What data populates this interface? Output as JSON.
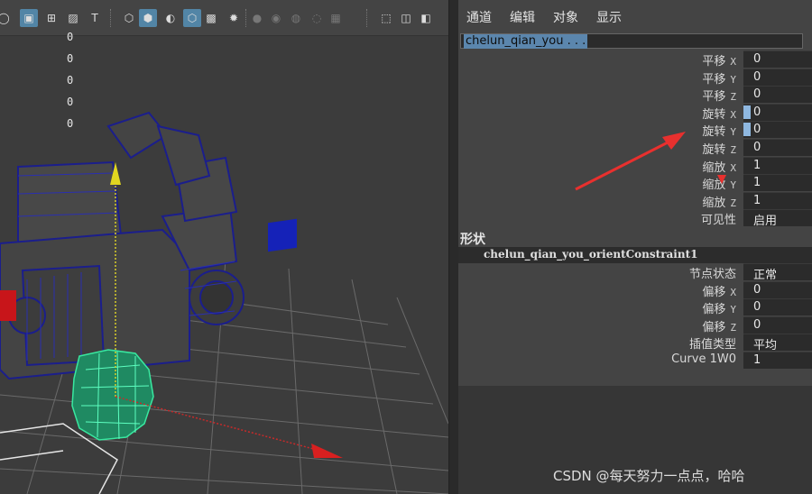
{
  "toolbar": {
    "icons": [
      {
        "name": "ring-icon",
        "glyph": "◯",
        "on": false,
        "dim": false
      },
      {
        "name": "film-gate-icon",
        "glyph": "▣",
        "on": true,
        "dim": false
      },
      {
        "name": "grid-icon",
        "glyph": "⊞",
        "on": false,
        "dim": false
      },
      {
        "name": "image-plane-icon",
        "glyph": "▨",
        "on": false,
        "dim": false
      },
      {
        "name": "text-icon",
        "glyph": "T",
        "on": false,
        "dim": false
      },
      {
        "name": "wireframe-cube-icon",
        "glyph": "⬡",
        "on": false,
        "dim": false
      },
      {
        "name": "smooth-shade-icon",
        "glyph": "⬢",
        "on": true,
        "dim": false
      },
      {
        "name": "default-material-icon",
        "glyph": "◐",
        "on": false,
        "dim": false
      },
      {
        "name": "wireframe-on-shaded-icon",
        "glyph": "⬡",
        "on": true,
        "dim": false
      },
      {
        "name": "xray-icon",
        "glyph": "▩",
        "on": false,
        "dim": false
      },
      {
        "name": "lights-icon",
        "glyph": "✹",
        "on": false,
        "dim": false
      },
      {
        "name": "shadows-icon",
        "glyph": "●",
        "on": false,
        "dim": true
      },
      {
        "name": "ambient-occlusion-icon",
        "glyph": "◉",
        "on": false,
        "dim": true
      },
      {
        "name": "motion-blur-icon",
        "glyph": "◍",
        "on": false,
        "dim": true
      },
      {
        "name": "antialias-icon",
        "glyph": "◌",
        "on": false,
        "dim": true
      },
      {
        "name": "depth-icon",
        "glyph": "▦",
        "on": false,
        "dim": true
      },
      {
        "name": "isolate-select-icon",
        "glyph": "⬚",
        "on": false,
        "dim": false
      },
      {
        "name": "xray-joints-icon",
        "glyph": "◫",
        "on": false,
        "dim": false
      },
      {
        "name": "xray-active-icon",
        "glyph": "◧",
        "on": false,
        "dim": false
      }
    ]
  },
  "viewport": {
    "channel_values": [
      "0",
      "0",
      "0",
      "0",
      "0"
    ]
  },
  "panel": {
    "menu": [
      "通道",
      "编辑",
      "对象",
      "显示"
    ],
    "object_name": "chelun_qian_you . . .",
    "attributes": [
      {
        "label": "平移",
        "axis": "X",
        "value": "0"
      },
      {
        "label": "平移",
        "axis": "Y",
        "value": "0"
      },
      {
        "label": "平移",
        "axis": "Z",
        "value": "0"
      },
      {
        "label": "旋转",
        "axis": "X",
        "value": "0"
      },
      {
        "label": "旋转",
        "axis": "Y",
        "value": "0"
      },
      {
        "label": "旋转",
        "axis": "Z",
        "value": "0"
      },
      {
        "label": "缩放",
        "axis": "X",
        "value": "1"
      },
      {
        "label": "缩放",
        "axis": "Y",
        "value": "1"
      },
      {
        "label": "缩放",
        "axis": "Z",
        "value": "1"
      },
      {
        "label": "可见性",
        "axis": "",
        "value": "启用"
      }
    ],
    "shape_heading": "形状",
    "input_node": "chelun_qian_you_orientConstraint1",
    "input_attributes": [
      {
        "label": "节点状态",
        "axis": "",
        "value": "正常"
      },
      {
        "label": "偏移",
        "axis": "X",
        "value": "0"
      },
      {
        "label": "偏移",
        "axis": "Y",
        "value": "0"
      },
      {
        "label": "偏移",
        "axis": "Z",
        "value": "0"
      },
      {
        "label": "插值类型",
        "axis": "",
        "value": "平均"
      },
      {
        "label": "Curve 1W0",
        "axis": "",
        "value": "1"
      }
    ]
  },
  "watermark": "CSDN @每天努力一点点，哈哈",
  "colors": {
    "accent": "#5b86ad",
    "wireframe": "#1b1e8c",
    "selected_wire": "#39e8a0",
    "annotation_arrow": "#e8302e"
  }
}
